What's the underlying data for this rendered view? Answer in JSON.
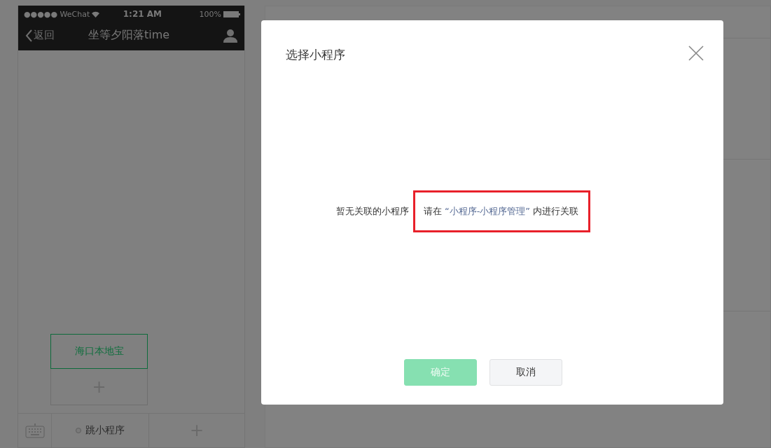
{
  "phone": {
    "status_bar": {
      "carrier": "●●●●● WeChat",
      "time": "1:21 AM",
      "battery": "100%"
    },
    "nav": {
      "back": "返回",
      "title": "坐等夕阳落time"
    },
    "menu_popup": {
      "items": [
        {
          "label": "海口本地宝",
          "selected": true
        }
      ],
      "add": "+"
    },
    "bottom_bar": {
      "menus": [
        {
          "label": "跳小程序"
        }
      ],
      "add": "+"
    }
  },
  "dialog": {
    "title": "选择小程序",
    "message": "暂无关联的小程序",
    "hint_prefix": "请在",
    "link": "“小程序-小程序管理”",
    "hint_suffix": "内进行关联",
    "highlighted": true,
    "buttons": [
      {
        "label": "确定",
        "kind": "primary",
        "disabled": true
      },
      {
        "label": "取消",
        "kind": "default",
        "disabled": false
      }
    ]
  }
}
